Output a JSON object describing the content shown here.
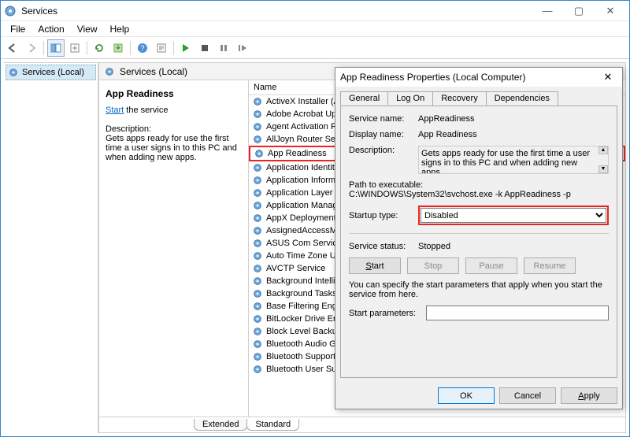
{
  "window": {
    "title": "Services"
  },
  "menubar": [
    "File",
    "Action",
    "View",
    "Help"
  ],
  "leftpane": {
    "root": "Services (Local)"
  },
  "rightpane": {
    "header": "Services (Local)",
    "column": "Name"
  },
  "detail": {
    "title": "App Readiness",
    "start_link": "Start",
    "start_suffix": " the service",
    "desc_label": "Description:",
    "desc": "Gets apps ready for use the first time a user signs in to this PC and when adding new apps."
  },
  "services": [
    "ActiveX Installer (Ax",
    "Adobe Acrobat Upd",
    "Agent Activation Ru",
    "AllJoyn Router Servi",
    "App Readiness",
    "Application Identity",
    "Application Informa",
    "Application Layer G",
    "Application Manage",
    "AppX Deployment S",
    "AssignedAccessMan",
    "ASUS Com Service",
    "Auto Time Zone Up",
    "AVCTP Service",
    "Background Intellig",
    "Background Tasks In",
    "Base Filtering Engin",
    "BitLocker Drive Encr",
    "Block Level Backup",
    "Bluetooth Audio Ga",
    "Bluetooth Support S",
    "Bluetooth User Sup"
  ],
  "highlight_index": 4,
  "bottom_tabs": {
    "extended": "Extended",
    "standard": "Standard"
  },
  "dialog": {
    "title": "App Readiness Properties (Local Computer)",
    "tabs": [
      "General",
      "Log On",
      "Recovery",
      "Dependencies"
    ],
    "labels": {
      "service_name": "Service name:",
      "display_name": "Display name:",
      "description": "Description:",
      "path": "Path to executable:",
      "startup": "Startup type:",
      "status": "Service status:",
      "hint": "You can specify the start parameters that apply when you start the service from here.",
      "params": "Start parameters:"
    },
    "values": {
      "service_name": "AppReadiness",
      "display_name": "App Readiness",
      "description": "Gets apps ready for use the first time a user signs in to this PC and when adding new apps.",
      "path": "C:\\WINDOWS\\System32\\svchost.exe -k AppReadiness -p",
      "startup": "Disabled",
      "status": "Stopped"
    },
    "buttons": {
      "start": "Start",
      "stop": "Stop",
      "pause": "Pause",
      "resume": "Resume",
      "ok": "OK",
      "cancel": "Cancel",
      "apply": "Apply"
    }
  }
}
